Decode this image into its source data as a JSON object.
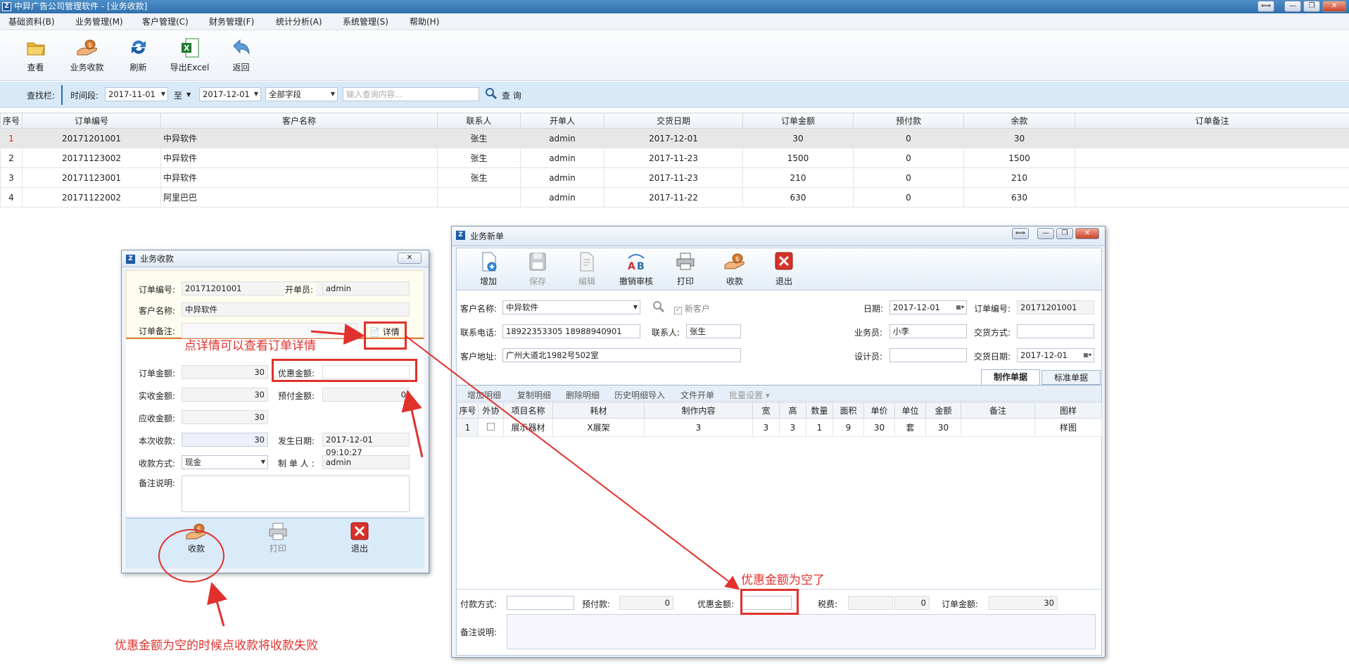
{
  "window": {
    "title": "中异广告公司管理软件 - [业务收款]",
    "min": "—",
    "max": "❐",
    "close": "✕",
    "restore": "⟺"
  },
  "menu": [
    "基础资料(B)",
    "业务管理(M)",
    "客户管理(C)",
    "财务管理(F)",
    "统计分析(A)",
    "系统管理(S)",
    "帮助(H)"
  ],
  "toolbar": {
    "view": "查看",
    "collect": "业务收款",
    "refresh": "刷新",
    "export": "导出Excel",
    "back": "返回"
  },
  "search": {
    "label": "查找栏:",
    "period_label": "时间段:",
    "from": "2017-11-01",
    "to_label": "至",
    "to": "2017-12-01",
    "field": "全部字段",
    "placeholder": "输入查询内容...",
    "button": "查 询"
  },
  "grid": {
    "headers": [
      "序号",
      "订单编号",
      "客户名称",
      "联系人",
      "开单人",
      "交货日期",
      "订单金额",
      "预付款",
      "余款",
      "订单备注"
    ],
    "rows": [
      [
        "1",
        "20171201001",
        "中异软件",
        "张生",
        "admin",
        "2017-12-01",
        "30",
        "0",
        "30",
        ""
      ],
      [
        "2",
        "20171123002",
        "中异软件",
        "张生",
        "admin",
        "2017-11-23",
        "1500",
        "0",
        "1500",
        ""
      ],
      [
        "3",
        "20171123001",
        "中异软件",
        "张生",
        "admin",
        "2017-11-23",
        "210",
        "0",
        "210",
        ""
      ],
      [
        "4",
        "20171122002",
        "阿里巴巴",
        "",
        "admin",
        "2017-11-22",
        "630",
        "0",
        "630",
        ""
      ]
    ]
  },
  "receipt_dialog": {
    "title": "业务收款",
    "order_no_label": "订单编号:",
    "order_no": "20171201001",
    "creator_label": "开单员:",
    "creator": "admin",
    "customer_label": "客户名称:",
    "customer": "中异软件",
    "remark_label": "订单备注:",
    "detail_btn": "详情",
    "amount_label": "订单金额:",
    "amount": "30",
    "discount_label": "优惠金额:",
    "discount": "",
    "received_label": "实收金额:",
    "received": "30",
    "prepaid_label": "预付金额:",
    "prepaid": "0",
    "receivable_label": "应收金额:",
    "receivable": "30",
    "this_label": "本次收款:",
    "this_amount": "30",
    "date_label": "发生日期:",
    "date": "2017-12-01 09:10:27",
    "method_label": "收款方式:",
    "method": "现金",
    "maker_label": "制 单 人 :",
    "maker": "admin",
    "note_label": "备注说明:",
    "btn_collect": "收款",
    "btn_print": "打印",
    "btn_exit": "退出"
  },
  "order_dialog": {
    "title": "业务新单",
    "tb": {
      "add": "增加",
      "save": "保存",
      "edit": "编辑",
      "unaudit": "撤销审核",
      "print": "打印",
      "collect": "收款",
      "exit": "退出"
    },
    "customer_label": "客户名称:",
    "customer": "中异软件",
    "new_customer": "新客户",
    "date_label": "日期:",
    "date": "2017-12-01",
    "order_no_label": "订单编号:",
    "order_no": "20171201001",
    "phone_label": "联系电话:",
    "phone": "18922353305 18988940901",
    "contact_label": "联系人:",
    "contact": "张生",
    "sales_label": "业务员:",
    "sales": "小李",
    "delivery_method_label": "交货方式:",
    "delivery_method": "",
    "address_label": "客户地址:",
    "address": "广州大道北1982号502室",
    "designer_label": "设计员:",
    "designer": "",
    "delivery_date_label": "交货日期:",
    "delivery_date": "2017-12-01",
    "tab_make": "制作单据",
    "tab_standard": "标准单据",
    "detail_tb": [
      "增加明细",
      "复制明细",
      "删除明细",
      "历史明细导入",
      "文件开单",
      "批量设置 ▾"
    ],
    "headers": [
      "序号",
      "外协",
      "项目名称",
      "耗材",
      "制作内容",
      "宽",
      "高",
      "数量",
      "面积",
      "单价",
      "单位",
      "金额",
      "备注",
      "图样"
    ],
    "rows": [
      [
        "1",
        "",
        "展示器材",
        "X展架",
        "3",
        "3",
        "3",
        "1",
        "9",
        "30",
        "套",
        "30",
        "",
        "样图"
      ]
    ],
    "pay_method_label": "付款方式:",
    "pay_method": "",
    "prepaid_label": "预付款:",
    "prepaid": "0",
    "discount_label": "优惠金额:",
    "discount": "",
    "tax_label": "税费:",
    "tax": "",
    "tax2": "0",
    "total_label": "订单金额:",
    "total": "30",
    "note_label": "备注说明:"
  },
  "annotations": {
    "detail_hint": "点详情可以查看订单详情",
    "empty_hint": "优惠金额为空了",
    "fail_hint": "优惠金额为空的时候点收款将收款失败"
  },
  "colors": {
    "accent_red": "#e0312d",
    "title_blue": "#2e6fae"
  }
}
